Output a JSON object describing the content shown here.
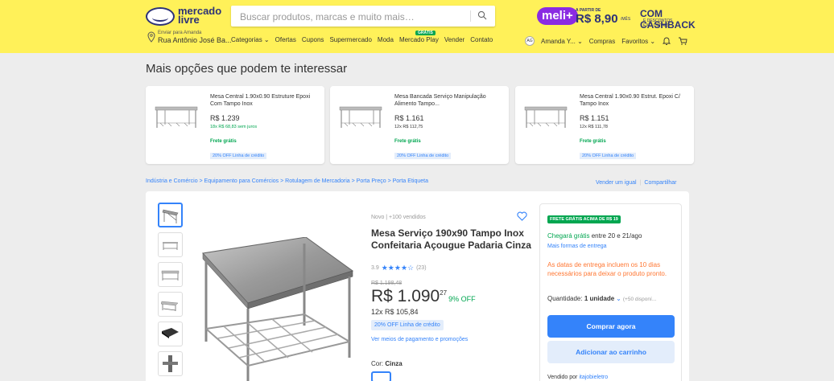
{
  "header": {
    "logo_text_1": "mercado",
    "logo_text_2": "livre",
    "search_placeholder": "Buscar produtos, marcas e muito mais…",
    "promo": {
      "meli": "meli+",
      "price_prefix": "A PARTIR DE",
      "price": "R$ 8,90",
      "per_month": "/MÊS",
      "cashback": "COM CASHBACK",
      "cashback_sub": "E DESCONTOS EXCLUSIVOS"
    },
    "address_label": "Enviar para Amanda",
    "address": "Rua Antônio José Ba...",
    "nav": [
      "Categorias ⌄",
      "Ofertas",
      "Cupons",
      "Supermercado",
      "Moda",
      "Mercado Play",
      "Vender",
      "Contato"
    ],
    "gratis_badge": "GRÁTIS",
    "user_initials": "AG",
    "user_name": "Amanda Y... ⌄",
    "purchases": "Compras",
    "favorites": "Favoritos ⌄"
  },
  "reco": {
    "title": "Mais opções que podem te interessar",
    "items": [
      {
        "title": "Mesa Central 1.90x0.90 Estruture Epoxi Com Tampo Inox",
        "price": "R$ 1.239",
        "installments": "18x R$ 68,83 sem juros",
        "shipping": "Frete grátis",
        "credit": "20% OFF Linha de crédito"
      },
      {
        "title": "Mesa Bancada Serviço Manipulação Alimento Tampo...",
        "price": "R$ 1.161",
        "installments": "12x R$ 112,75",
        "shipping": "Frete grátis",
        "credit": "20% OFF Linha de crédito"
      },
      {
        "title": "Mesa Central 1.90x0.90 Estrut. Epoxi C/ Tampo Inox",
        "price": "R$ 1.151",
        "installments": "12x R$ 111,78",
        "shipping": "Frete grátis",
        "credit": "20% OFF Linha de crédito"
      }
    ]
  },
  "breadcrumb": "Indústria e Comércio > Equipamento para Comércios > Rotulagem de Mercadoria > Porta Preço > Porta Etiqueta",
  "sell_link": "Vender um igual",
  "share_link": "Compartilhar",
  "product": {
    "condition": "Novo  |  +100 vendidos",
    "title": "Mesa Serviço 190x90 Tampo Inox Confeitaria Açougue Padaria Cinza",
    "rating_value": "3.9",
    "stars": "★★★★☆",
    "reviews": "(23)",
    "old_price": "R$ 1.198,48",
    "price_main": "R$ 1.090",
    "price_cents": "27",
    "discount": "9% OFF",
    "installments": "12x R$ 105,84",
    "credit": "20% OFF Linha de crédito",
    "payment_link": "Ver meios de pagamento e promoções",
    "color_label": "Cor:",
    "color_value": "Cinza"
  },
  "buybox": {
    "badge": "FRETE GRÁTIS ACIMA DE R$ 19",
    "arrival_green": "Chegará grátis",
    "arrival_rest": " entre 20 e 21/ago",
    "more_ship": "Mais formas de entrega",
    "warning": "As datas de entrega incluem os 10 dias necessários para deixar o produto pronto.",
    "qty_label": "Quantidade:",
    "qty_value": "1 unidade",
    "qty_avail": "(+50 disponí...",
    "buy": "Comprar agora",
    "cart": "Adicionar ao carrinho",
    "seller_label": "Vendido por ",
    "seller": "itajobieletro"
  },
  "colors": {
    "header": "#fff159",
    "accent": "#3483fa",
    "green": "#00a650",
    "warning": "#ff7733"
  }
}
